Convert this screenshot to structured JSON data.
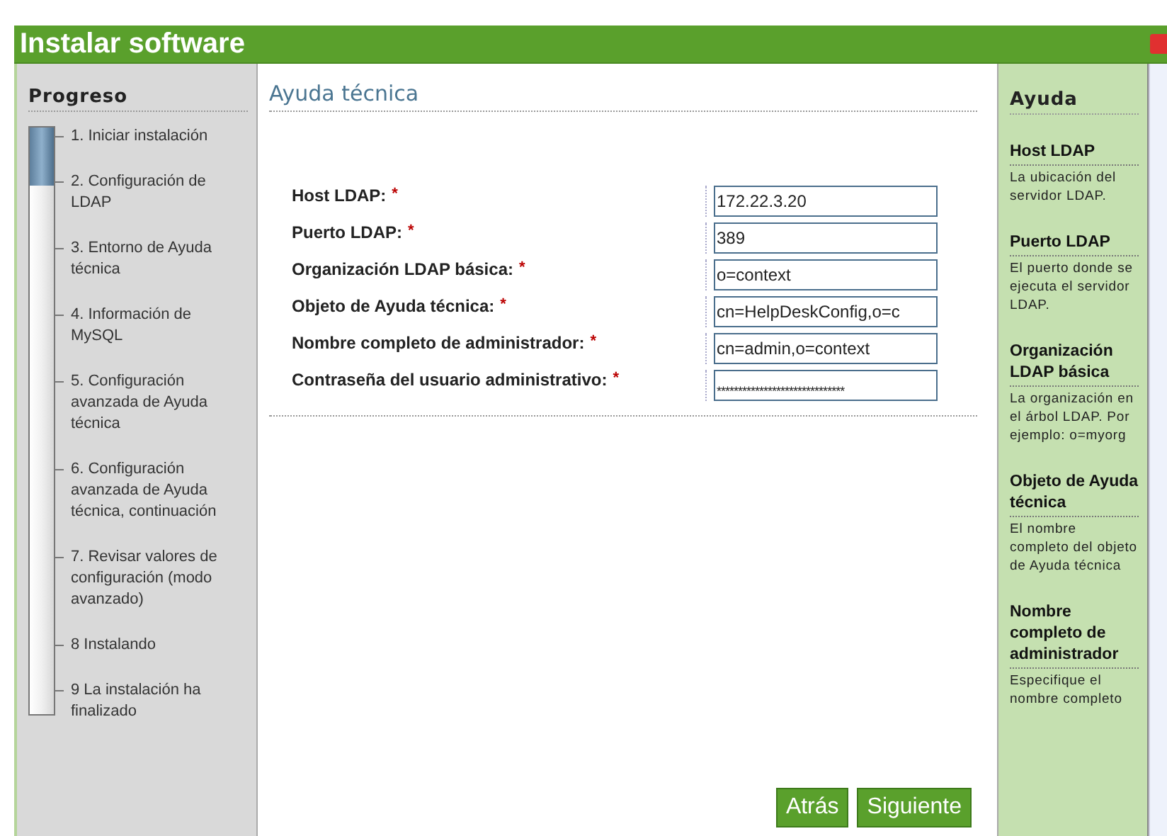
{
  "window": {
    "title": "Instalar software"
  },
  "progress": {
    "title": "Progreso",
    "level": 0.1,
    "steps": [
      {
        "label": "1. Iniciar instalación"
      },
      {
        "label": "2. Configuración de LDAP"
      },
      {
        "label": "3. Entorno de Ayuda técnica"
      },
      {
        "label": "4. Información de MySQL"
      },
      {
        "label": "5. Configuración avanzada de Ayuda técnica"
      },
      {
        "label": "6. Configuración avanzada de Ayuda técnica, continuación"
      },
      {
        "label": "7. Revisar valores de configuración (modo avanzado)"
      },
      {
        "label": "8 Instalando"
      },
      {
        "label": "9 La instalación ha finalizado"
      }
    ]
  },
  "main": {
    "title": "Ayuda técnica",
    "fields": [
      {
        "label": "Host LDAP:",
        "required_mark": "*",
        "value": "172.22.3.20"
      },
      {
        "label": "Puerto LDAP:",
        "required_mark": "*",
        "value": "389"
      },
      {
        "label": "Organización LDAP básica:",
        "required_mark": "*",
        "value": "o=context"
      },
      {
        "label": "Objeto de Ayuda técnica:",
        "required_mark": "*",
        "value": "cn=HelpDeskConfig,o=c"
      },
      {
        "label": "Nombre completo de administrador:",
        "required_mark": "*",
        "value": "cn=admin,o=context"
      },
      {
        "label": "Contraseña del usuario administrativo:",
        "required_mark": "*",
        "kind": "password",
        "value": "******************************"
      }
    ],
    "buttons": [
      "Atrás",
      "Siguiente"
    ]
  },
  "help": {
    "title": "Ayuda",
    "items": [
      {
        "heading": "Host LDAP",
        "text": "La ubicación del servidor LDAP."
      },
      {
        "heading": "Puerto LDAP",
        "text": "El puerto donde se ejecuta el servidor LDAP."
      },
      {
        "heading": "Organización LDAP básica",
        "text": "La organización en el árbol LDAP. Por ejemplo: o=myorg"
      },
      {
        "heading": "Objeto de Ayuda técnica",
        "text": "El nombre completo del objeto de Ayuda técnica"
      },
      {
        "heading": "Nombre completo de administrador",
        "text": "Especifique el nombre completo"
      }
    ]
  }
}
